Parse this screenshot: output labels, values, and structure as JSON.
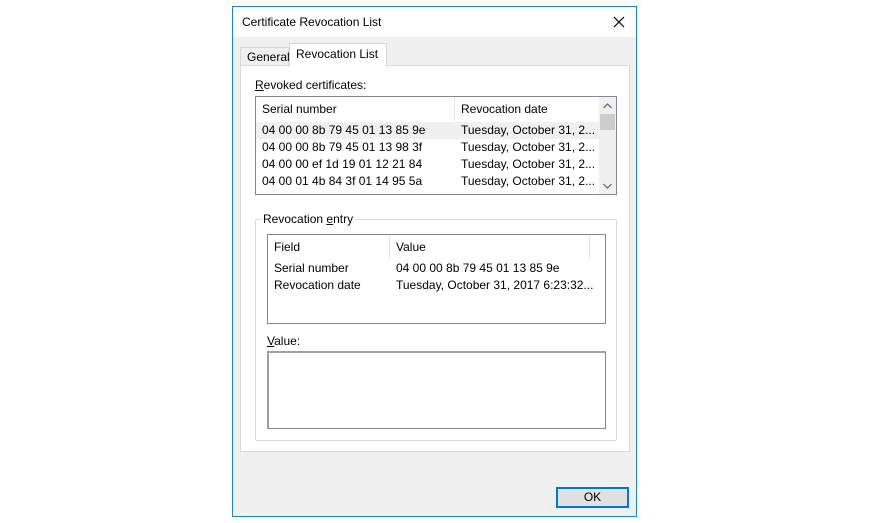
{
  "window": {
    "title": "Certificate Revocation List"
  },
  "tabs": [
    {
      "label": "General",
      "active": false
    },
    {
      "label": "Revocation List",
      "active": true
    }
  ],
  "revoked": {
    "label_underlined": "R",
    "label_rest": "evoked certificates:",
    "columns": [
      "Serial number",
      "Revocation date"
    ],
    "rows": [
      {
        "serial": "04 00 00 8b 79 45 01 13 85 9e",
        "date": "Tuesday, October 31, 2...",
        "selected": true
      },
      {
        "serial": "04 00 00 8b 79 45 01 13 98 3f",
        "date": "Tuesday, October 31, 2...",
        "selected": false
      },
      {
        "serial": "04 00 00 ef 1d 19 01 12 21 84",
        "date": "Tuesday, October 31, 2...",
        "selected": false
      },
      {
        "serial": "04 00 01 4b 84 3f 01 14 95 5a",
        "date": "Tuesday, October 31, 2...",
        "selected": false
      }
    ]
  },
  "entry": {
    "group_title_pre": "Revocation ",
    "group_title_underlined": "e",
    "group_title_post": "ntry",
    "columns": [
      "Field",
      "Value"
    ],
    "rows": [
      {
        "field": "Serial number",
        "value": "04 00 00 8b 79 45 01 13 85 9e"
      },
      {
        "field": "Revocation date",
        "value": "Tuesday, October 31, 2017 6:23:32..."
      }
    ]
  },
  "value": {
    "label_underlined": "V",
    "label_rest": "alue:",
    "text": ""
  },
  "buttons": {
    "ok": "OK"
  },
  "colors": {
    "accent": "#0078d7",
    "selection": "#f0f0f0",
    "dialog_bg": "#f0f0f0"
  }
}
